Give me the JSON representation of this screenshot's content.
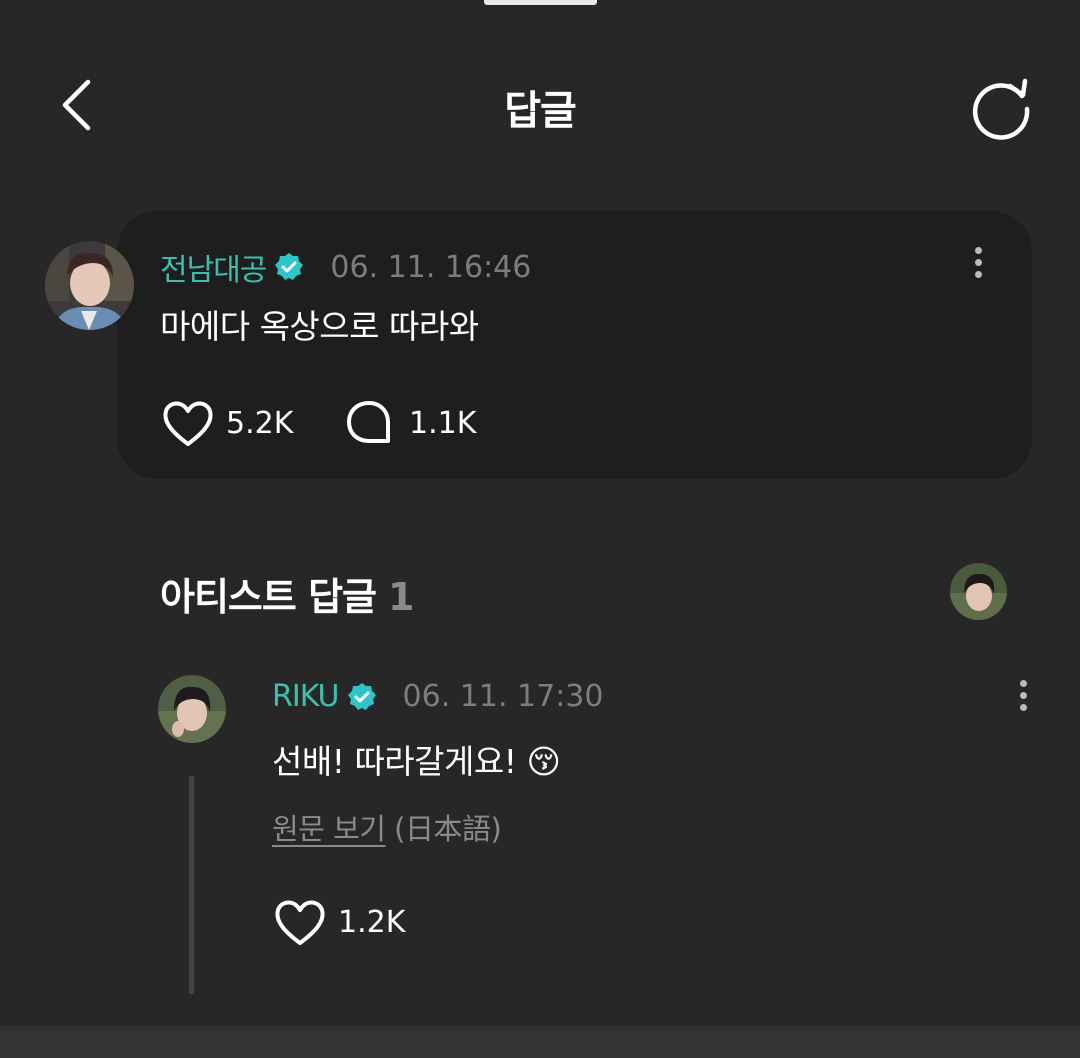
{
  "header": {
    "title": "답글",
    "back_icon": "chevron-left-icon",
    "refresh_icon": "refresh-icon"
  },
  "comment": {
    "author": "전남대공",
    "verified": true,
    "timestamp": "06. 11. 16:46",
    "text": "마에다 옥상으로 따라와",
    "likes": "5.2K",
    "replies": "1.1K"
  },
  "artist_replies": {
    "title": "아티스트 답글",
    "count": "1"
  },
  "reply": {
    "author": "RIKU",
    "verified": true,
    "timestamp": "06. 11. 17:30",
    "text": "선배! 따라갈게요! 😚",
    "view_original": "원문 보기",
    "language": "(日本語)",
    "likes": "1.2K"
  },
  "colors": {
    "background": "#272727",
    "card": "#1e1e1e",
    "accent": "#3dbfae",
    "verified_badge": "#2ec4ca",
    "muted": "#7d7d7d"
  }
}
